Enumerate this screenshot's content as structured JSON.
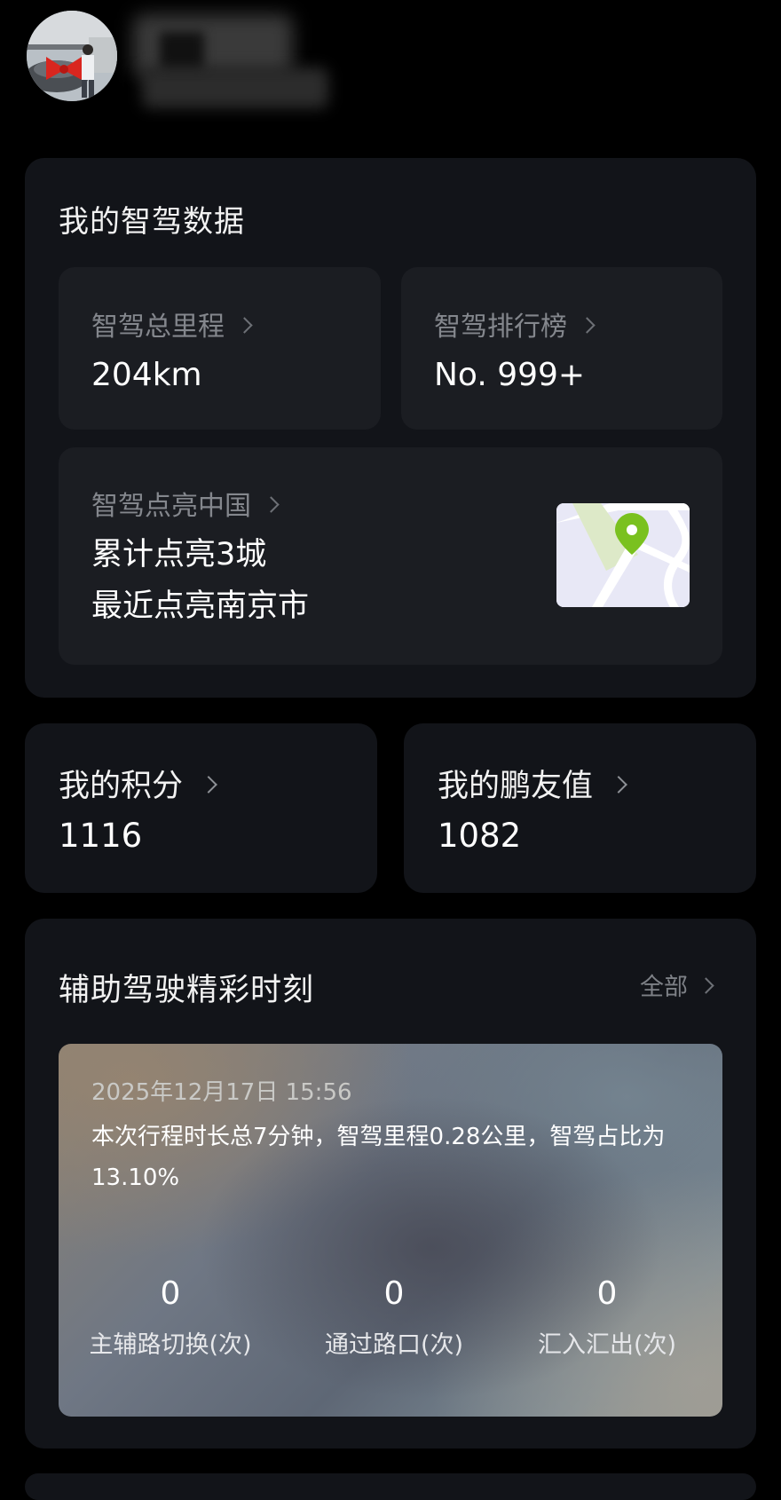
{
  "profile": {
    "username": ""
  },
  "smart_driving": {
    "title": "我的智驾数据",
    "total_mileage": {
      "label": "智驾总里程",
      "value": "204km"
    },
    "ranking": {
      "label": "智驾排行榜",
      "value": "No. 999+"
    },
    "light_up_china": {
      "label": "智驾点亮中国",
      "line1": "累计点亮3城",
      "line2": "最近点亮南京市"
    }
  },
  "points": {
    "label": "我的积分",
    "value": "1116"
  },
  "friend_value": {
    "label": "我的鹏友值",
    "value": "1082"
  },
  "moments": {
    "title": "辅助驾驶精彩时刻",
    "all_label": "全部",
    "card": {
      "datetime": "2025年12月17日  15:56",
      "description": "本次行程时长总7分钟，智驾里程0.28公里，智驾占比为13.10%",
      "stats": [
        {
          "value": "0",
          "label": "主辅路切换(次)"
        },
        {
          "value": "0",
          "label": "通过路口(次)"
        },
        {
          "value": "0",
          "label": "汇入汇出(次)"
        }
      ]
    }
  },
  "colors": {
    "background": "#000000",
    "card": "#121419",
    "tile": "#1b1d22",
    "map_pin": "#7ac11f"
  },
  "icons": [
    "avatar",
    "chevron-right-icon",
    "map-pin-icon"
  ]
}
